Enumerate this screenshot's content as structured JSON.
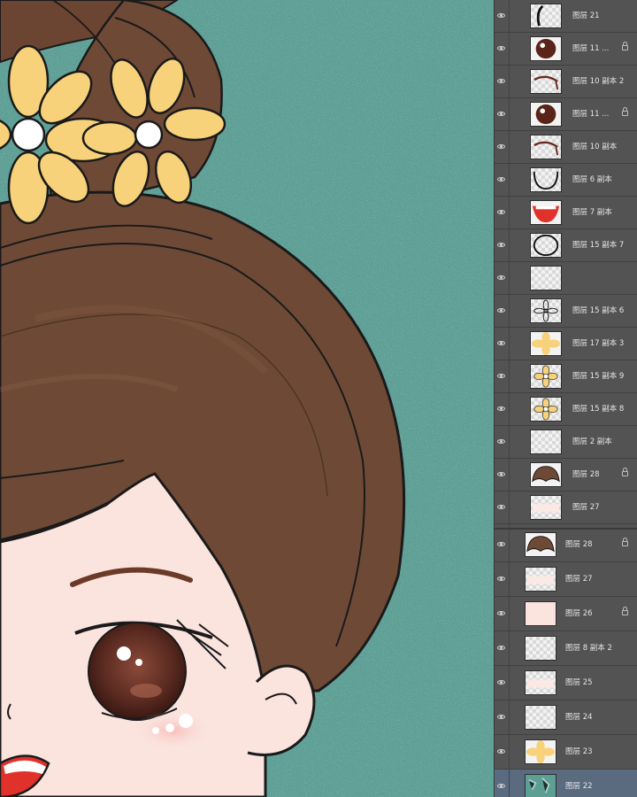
{
  "app": {
    "name": "Photoshop layers panel"
  },
  "colors": {
    "canvas_bg": "#5e9f95",
    "hair": "#6e4a36",
    "skin": "#fbe3de",
    "flower": "#f7d27a",
    "panel": "#535353",
    "selected_row": "#5a6b80"
  },
  "layers_top": [
    {
      "name": "图层 21",
      "thumb": "stroke-icon",
      "lock": false
    },
    {
      "name": "图层 11 ...",
      "thumb": "eye-ball-icon",
      "lock": true
    },
    {
      "name": "图层 10 副本 2",
      "thumb": "lash-arc-icon",
      "lock": false
    },
    {
      "name": "图层 11 ...",
      "thumb": "eye-ball-icon",
      "lock": true
    },
    {
      "name": "图层 10 副本",
      "thumb": "lash-arc-icon",
      "lock": false
    },
    {
      "name": "图层 6 副本",
      "thumb": "face-outline-icon",
      "lock": false
    },
    {
      "name": "图层 7 副本",
      "thumb": "mouth-icon",
      "lock": false
    },
    {
      "name": "图层 15 副本 7",
      "thumb": "circle-outline-icon",
      "lock": false
    },
    {
      "name": "",
      "thumb": "blank",
      "lock": false
    },
    {
      "name": "图层 15 副本 6",
      "thumb": "flower-outline-icon",
      "lock": false
    },
    {
      "name": "图层 17 副本 3",
      "thumb": "flower-filled-icon",
      "lock": false
    },
    {
      "name": "图层 15 副本 9",
      "thumb": "flower-icon",
      "lock": false
    },
    {
      "name": "图层 15 副本 8",
      "thumb": "flower-icon",
      "lock": false
    },
    {
      "name": "图层 2 副本",
      "thumb": "blank",
      "lock": false
    },
    {
      "name": "图层 28",
      "thumb": "hair-bun-icon",
      "lock": true
    },
    {
      "name": "图层 27",
      "thumb": "blank-pink",
      "lock": false
    },
    {
      "name": "图层 26",
      "thumb": "skin-icon",
      "lock": true
    },
    {
      "name": "",
      "thumb": "skin-icon",
      "lock": false
    }
  ],
  "layers_bottom": [
    {
      "name": "图层 28",
      "thumb": "hair-bun-icon",
      "lock": true
    },
    {
      "name": "图层 27",
      "thumb": "blank-pink",
      "lock": false
    },
    {
      "name": "图层 26",
      "thumb": "skin-icon",
      "lock": true
    },
    {
      "name": "图层 8 副本 2",
      "thumb": "blank",
      "lock": false
    },
    {
      "name": "图层 25",
      "thumb": "blank-pink",
      "lock": false
    },
    {
      "name": "图层 24",
      "thumb": "blank",
      "lock": false
    },
    {
      "name": "图层 23",
      "thumb": "flower-filled-icon",
      "lock": false
    },
    {
      "name": "图层 22",
      "thumb": "teal-bg-icon",
      "lock": false,
      "selected": true
    }
  ]
}
